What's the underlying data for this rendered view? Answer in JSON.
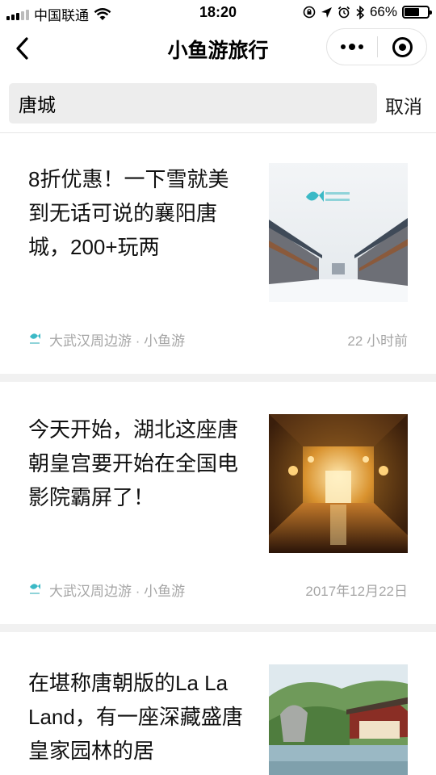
{
  "status_bar": {
    "carrier": "中国联通",
    "time": "18:20",
    "battery": "66%",
    "battery_level": 0.66
  },
  "nav": {
    "title": "小鱼游旅行"
  },
  "search": {
    "query": "唐城",
    "cancel_label": "取消"
  },
  "articles": [
    {
      "title": "8折优惠！一下雪就美到无话可说的襄阳唐城，200+玩两",
      "source": "大武汉周边游 · 小鱼游",
      "time": "22 小时前"
    },
    {
      "title": "今天开始，湖北这座唐朝皇宫要开始在全国电影院霸屏了！",
      "source": "大武汉周边游 · 小鱼游",
      "time": "2017年12月22日"
    },
    {
      "title": "在堪称唐朝版的La La Land，有一座深藏盛唐皇家园林的居"
    }
  ],
  "colors": {
    "accent_teal": "#3bb9c6",
    "meta_gray": "#a6a6a6",
    "search_bg": "#ededed",
    "separator": "#f1f1f1"
  }
}
